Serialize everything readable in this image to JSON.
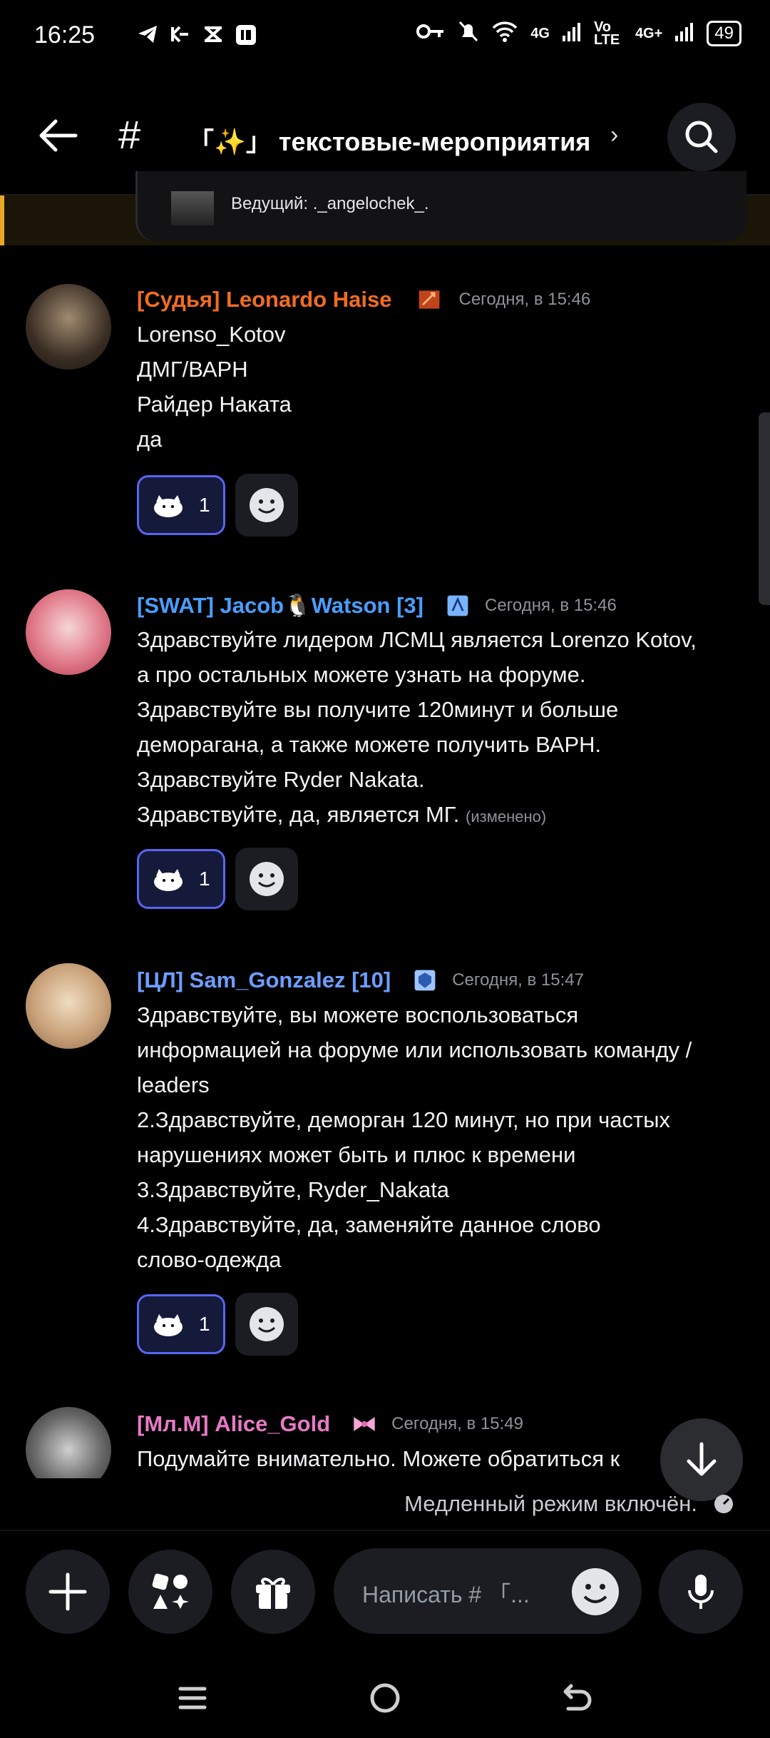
{
  "status_bar": {
    "time": "16:25",
    "network_1": "4G",
    "network_2": "Vo LTE",
    "network_3": "4G+",
    "battery": "49"
  },
  "header": {
    "hash": "#",
    "channel_name": "「✨」 текстовые-мероприятия",
    "chevron": "›"
  },
  "pinned": {
    "text": "Ведущий: ._angelochek_."
  },
  "messages": [
    {
      "author": "[Судья] Leonardo Haise",
      "author_color": "#f26c22",
      "time": "Сегодня, в 15:46",
      "lines": [
        "Lorenso_Kotov",
        "ДМГ/ВАРН",
        "Райдер Наката",
        "да"
      ],
      "reaction_count": "1"
    },
    {
      "author": "[SWAT] Jacob🐧Watson [3]",
      "author_color": "#4a9eff",
      "time": "Сегодня, в 15:46",
      "lines": [
        "Здравствуйте лидером ЛСМЦ является Lorenzo Kotov,",
        "а про остальных можете узнать на форуме.",
        "Здравствуйте вы получите 120минут и больше",
        "деморагана, а также можете получить ВАРН.",
        "Здравствуйте Ryder Nakata.",
        "Здравствуйте, да, является МГ."
      ],
      "edited": "(изменено)",
      "reaction_count": "1"
    },
    {
      "author": "[ЦЛ] Sam_Gonzalez [10]",
      "author_color": "#6d9eff",
      "time": "Сегодня, в 15:47",
      "lines": [
        "Здравствуйте, вы можете воспользоваться",
        "информацией на форуме или использовать команду /",
        "leaders",
        "2.Здравствуйте, деморган 120 минут, но при частых",
        "нарушениях может быть и плюс к времени",
        "3.Здравствуйте, Ryder_Nakata",
        "4.Здравствуйте, да, заменяйте данное слово",
        "слово-одежда"
      ],
      "reaction_count": "1"
    },
    {
      "author": "[Мл.М] Alice_Gold",
      "author_color": "#e879c6",
      "time": "Сегодня, в 15:49",
      "lines": [
        "Подумайте внимательно. Можете обратиться к"
      ]
    }
  ],
  "slowmode": "Медленный режим включён.",
  "composer": {
    "placeholder": "Написать #  「..."
  },
  "colors": {
    "accent": "#5865f2",
    "pinned_bar": "#e8a826",
    "surface": "#1c1d22"
  }
}
